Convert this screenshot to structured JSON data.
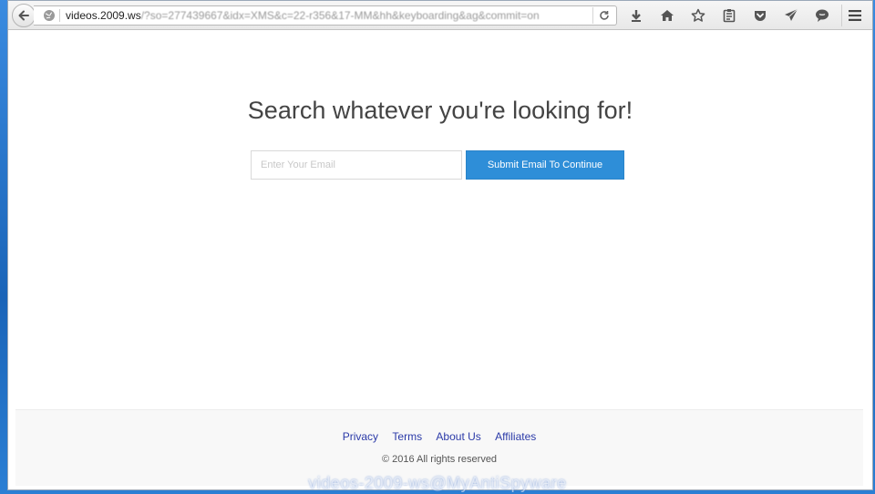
{
  "browser": {
    "url_host": "videos.2009.ws",
    "url_path": "/?so=277439667&idx=XMS&c=22-r356&17-MM&hh&keyboarding&ag&commit=on"
  },
  "page": {
    "headline": "Search whatever you're looking for!",
    "email_placeholder": "Enter Your Email",
    "email_value": "",
    "submit_label": "Submit Email To Continue"
  },
  "footer": {
    "links": [
      "Privacy",
      "Terms",
      "About Us",
      "Affiliates"
    ],
    "copyright": "© 2016 All rights reserved"
  },
  "watermark": "videos-2009-ws@MyAntiSpyware",
  "colors": {
    "accent_button": "#2e8ed8",
    "footer_link": "#2b3aa8",
    "desktop_bg": "#1a64b8"
  },
  "icons": [
    "back-arrow-icon",
    "globe-icon",
    "reload-icon",
    "download-icon",
    "home-icon",
    "star-icon",
    "reading-list-icon",
    "pocket-icon",
    "send-icon",
    "chat-icon",
    "hamburger-menu-icon"
  ]
}
